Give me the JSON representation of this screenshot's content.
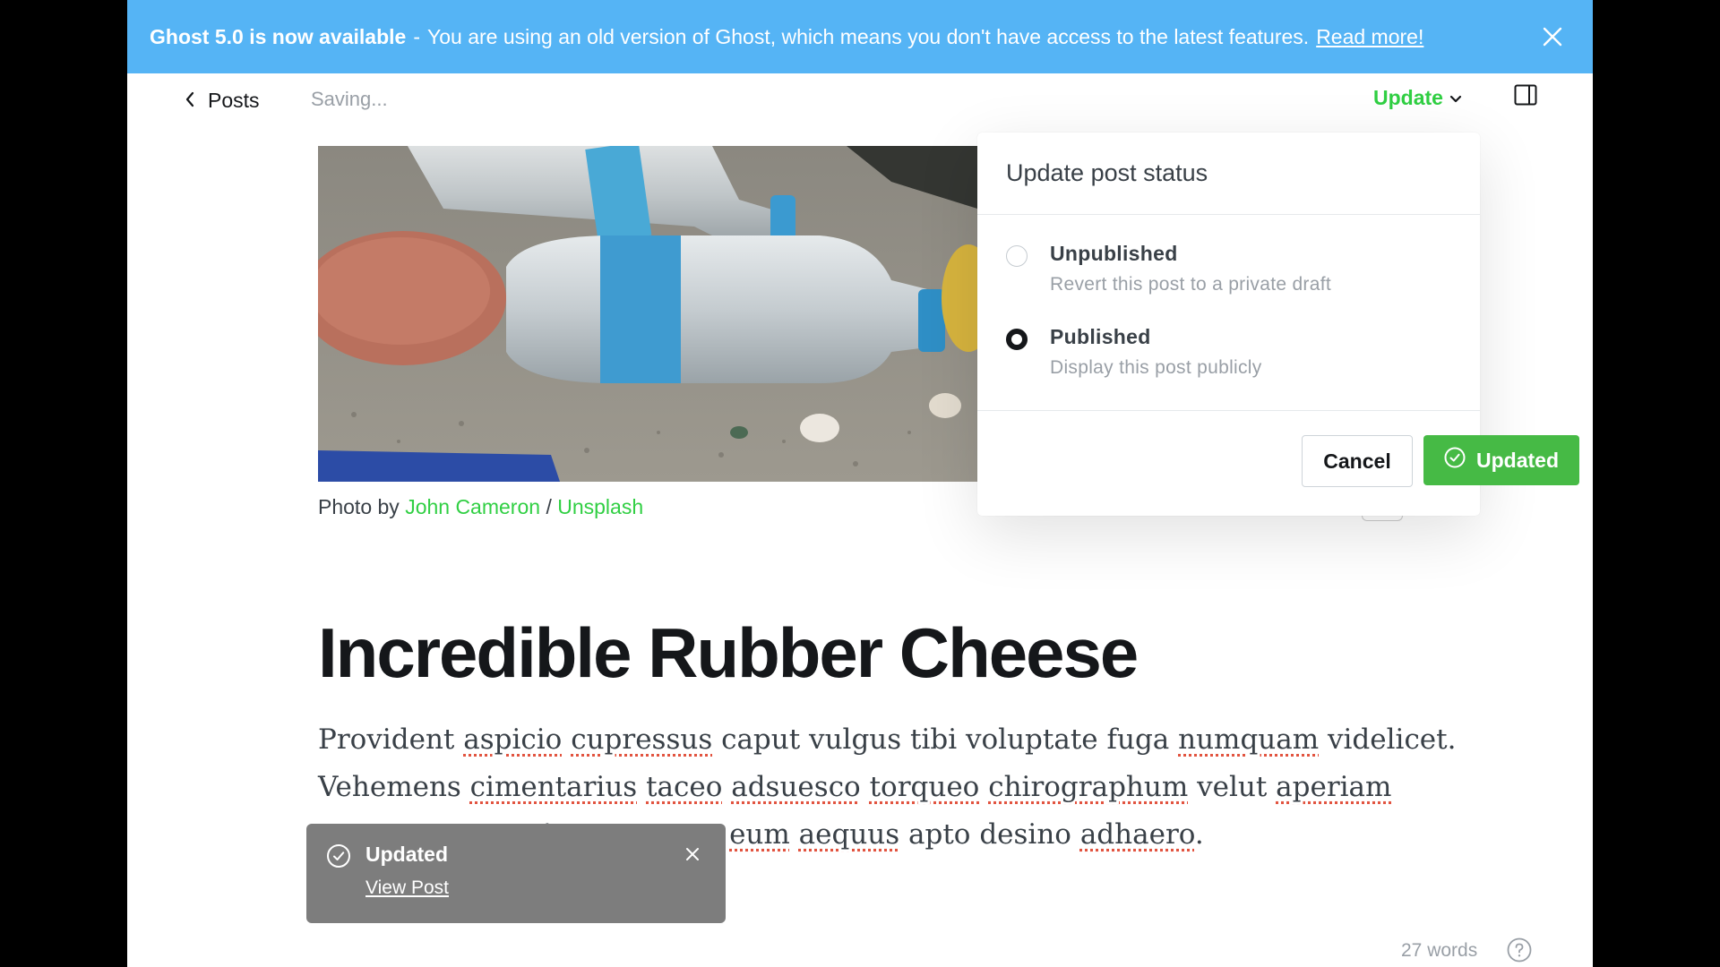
{
  "banner": {
    "title": "Ghost 5.0 is now available",
    "separator": "-",
    "message": "You are using an old version of Ghost, which means you don't have access to the latest features.",
    "link": "Read more!",
    "close_icon": "close-icon",
    "color": "#55b4f5"
  },
  "header": {
    "back_label": "Posts",
    "back_icon": "chevron-left-icon",
    "status": "Saving...",
    "update_label": "Update",
    "update_icon": "chevron-down-icon",
    "sidebar_icon": "sidebar-toggle-icon"
  },
  "feature_image": {
    "caption_prefix": "Photo by",
    "author": "John Cameron",
    "separator": "/",
    "source": "Unsplash"
  },
  "post": {
    "title": "Incredible Rubber Cheese",
    "body": [
      {
        "t": "Provident ",
        "s": false
      },
      {
        "t": "aspicio",
        "s": true
      },
      {
        "t": " ",
        "s": false
      },
      {
        "t": "cupressus",
        "s": true
      },
      {
        "t": " caput vulgus tibi voluptate fuga ",
        "s": false
      },
      {
        "t": "numquam",
        "s": true
      },
      {
        "t": " videlicet. Vehemens ",
        "s": false
      },
      {
        "t": "cimentarius",
        "s": true
      },
      {
        "t": " ",
        "s": false
      },
      {
        "t": "taceo",
        "s": true
      },
      {
        "t": " ",
        "s": false
      },
      {
        "t": "adsuesco",
        "s": true
      },
      {
        "t": " ",
        "s": false
      },
      {
        "t": "torqueo",
        "s": true
      },
      {
        "t": " ",
        "s": false
      },
      {
        "t": "chirographum",
        "s": true
      },
      {
        "t": " velut ",
        "s": false
      },
      {
        "t": "aperiam",
        "s": true
      },
      {
        "t": " cognomen ",
        "s": false
      },
      {
        "t": "eos",
        "s": true
      },
      {
        "t": ". Annus ",
        "s": false
      },
      {
        "t": "neque",
        "s": true
      },
      {
        "t": " ",
        "s": false
      },
      {
        "t": "eum",
        "s": true
      },
      {
        "t": " ",
        "s": false
      },
      {
        "t": "aequus",
        "s": true
      },
      {
        "t": " apto desino ",
        "s": false
      },
      {
        "t": "adhaero",
        "s": true
      },
      {
        "t": ".",
        "s": false
      }
    ],
    "word_count": "27 words",
    "help_icon": "help-circle-icon"
  },
  "publish_menu": {
    "heading": "Update post status",
    "options": [
      {
        "title": "Unpublished",
        "description": "Revert this post to a private draft",
        "selected": false
      },
      {
        "title": "Published",
        "description": "Display this post publicly",
        "selected": true
      }
    ],
    "cancel_label": "Cancel",
    "confirm_label": "Updated",
    "confirm_icon": "check-circle-icon",
    "confirm_color": "#46ba45"
  },
  "toast": {
    "title": "Updated",
    "link": "View Post",
    "icon": "check-circle-icon",
    "close_icon": "close-icon"
  },
  "colors": {
    "accent_green": "#30cf43",
    "text_dark": "#15171a",
    "text_muted": "#999fa6"
  }
}
